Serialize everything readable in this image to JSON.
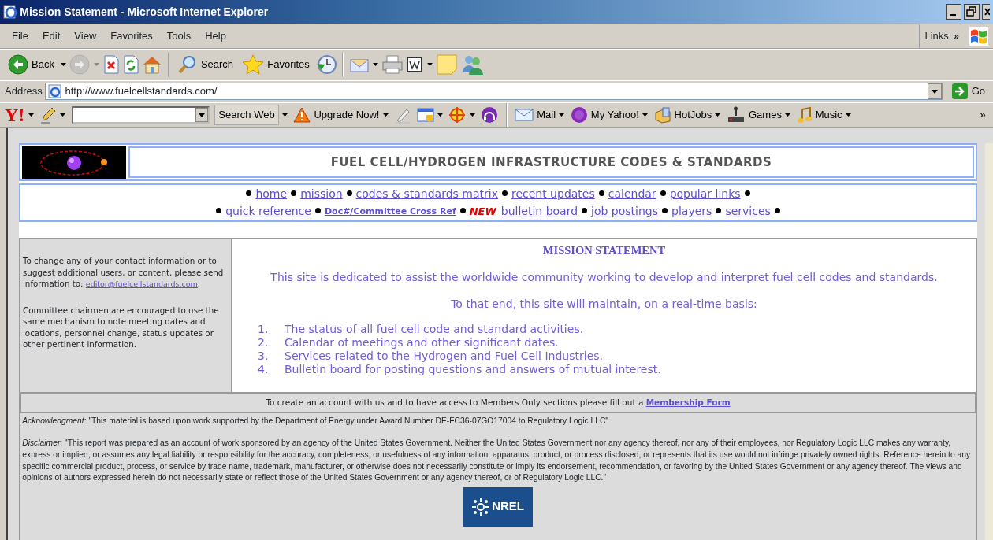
{
  "window": {
    "title": "Mission Statement - Microsoft Internet Explorer"
  },
  "menu": [
    "File",
    "Edit",
    "View",
    "Favorites",
    "Tools",
    "Help"
  ],
  "links_bar": {
    "label": "Links",
    "more": "»"
  },
  "toolbar": [
    {
      "kind": "back",
      "label": "Back",
      "disabled": false,
      "dropdown": true
    },
    {
      "kind": "forward",
      "disabled": true,
      "dropdown": true
    },
    {
      "kind": "stop",
      "disabled": false,
      "dropdown": false
    },
    {
      "kind": "refresh",
      "disabled": false,
      "dropdown": false
    },
    {
      "kind": "home",
      "disabled": false,
      "dropdown": false
    },
    {
      "kind": "separator"
    },
    {
      "kind": "search",
      "label": "Search",
      "disabled": false,
      "dropdown": false
    },
    {
      "kind": "favorites",
      "label": "Favorites",
      "disabled": false,
      "dropdown": false
    },
    {
      "kind": "history",
      "disabled": false,
      "dropdown": false
    },
    {
      "kind": "separator"
    },
    {
      "kind": "mail",
      "disabled": false,
      "dropdown": true
    },
    {
      "kind": "print",
      "disabled": false,
      "dropdown": false
    },
    {
      "kind": "edit",
      "disabled": false,
      "dropdown": true
    },
    {
      "kind": "note",
      "disabled": false,
      "dropdown": false
    },
    {
      "kind": "messenger",
      "disabled": false,
      "dropdown": false
    }
  ],
  "address": {
    "label": "Address",
    "url": "http://www.fuelcellstandards.com/",
    "go": "Go"
  },
  "yahoo_bar": [
    {
      "kind": "logo",
      "label": "Y!",
      "dropdown": true
    },
    {
      "kind": "pencil",
      "dropdown": true
    },
    {
      "kind": "search_field"
    },
    {
      "kind": "button",
      "label": "Search Web",
      "dropdown": true
    },
    {
      "kind": "warning",
      "label": "Upgrade Now!",
      "dropdown": true
    },
    {
      "kind": "highlighter",
      "dropdown": false
    },
    {
      "kind": "window",
      "dropdown": true
    },
    {
      "kind": "target",
      "dropdown": true
    },
    {
      "kind": "headphones",
      "dropdown": false
    },
    {
      "kind": "separator"
    },
    {
      "kind": "mail",
      "label": "Mail",
      "dropdown": true
    },
    {
      "kind": "myyahoo",
      "label": "My Yahoo!",
      "dropdown": true
    },
    {
      "kind": "hotjobs",
      "label": "HotJobs",
      "dropdown": true
    },
    {
      "kind": "games",
      "label": "Games",
      "dropdown": true
    },
    {
      "kind": "music",
      "label": "Music",
      "dropdown": true
    },
    {
      "kind": "more",
      "label": "»"
    }
  ],
  "header": {
    "title": "FUEL CELL/HYDROGEN INFRASTRUCTURE CODES & STANDARDS"
  },
  "nav": [
    [
      {
        "label": "home"
      },
      {
        "label": "mission"
      },
      {
        "label": "codes & standards matrix"
      },
      {
        "label": "recent updates"
      },
      {
        "label": "calendar"
      },
      {
        "label": "popular links"
      }
    ],
    [
      {
        "label": "quick reference"
      },
      {
        "label": "Doc#/Committee Cross Ref",
        "kind": "small"
      },
      {
        "label": "bulletin board",
        "badge": "NEW"
      },
      {
        "label": "job postings"
      },
      {
        "label": "players"
      },
      {
        "label": "services"
      }
    ]
  ],
  "sidebar": {
    "contact_text": "To change any of your contact information or to suggest additional users, or content, please send information to: ",
    "email": "editor@fuelcellstandards.com",
    "contact_end": ".",
    "committee_text": "Committee chairmen are encouraged to use the same mechanism to note meeting dates and locations, personnel change, status updates or other pertinent information."
  },
  "main": {
    "heading": "MISSION STATEMENT",
    "intro": "This site is dedicated to assist the worldwide community working to develop and interpret fuel cell codes and standards.",
    "subintro": "To that end, this site will maintain, on a real-time basis:",
    "items": [
      {
        "number": "1.",
        "text": "The status of all fuel cell code and standard activities."
      },
      {
        "number": "2.",
        "text": "Calendar of meetings and other significant dates."
      },
      {
        "number": "3.",
        "text": "Services related to the Hydrogen and Fuel Cell Industries."
      },
      {
        "number": "4.",
        "text": "Bulletin board for posting questions and answers of mutual interest."
      }
    ]
  },
  "membership": {
    "text": "To create an account with us and to have access to Members Only sections please fill out a ",
    "link": "Membership Form"
  },
  "acknowledgment": "*Acknowledgment*:  \"This material is based upon work supported by the Department of Energy  under Award Number DE-FC36-07GO17004 to Regulatory Logic LLC\"",
  "disclaimer": "*Disclaimer*:  \"This report was prepared as an account of work sponsored by an agency of the United States Government.  Neither the United States Government nor any agency thereof, nor any of their employees, nor Regulatory Logic LLC makes any warranty, express or implied, or assumes any legal liability or responsibility for the accuracy, completeness, or usefulness of any information, apparatus, product, or process disclosed, or represents that its use would not infringe privately owned rights.  Reference herein to any specific commercial product, process, or service by trade name, trademark, manufacturer, or otherwise does not necessarily constitute or imply its endorsement, recommendation, or favoring by the United States Government or any agency thereof.  The views and opinions of authors expressed herein do not necessarily state or reflect those of the United States Government or any agency thereof, or of Regulatory Logic LLC.\"",
  "footer_logo": {
    "text": "NREL"
  }
}
